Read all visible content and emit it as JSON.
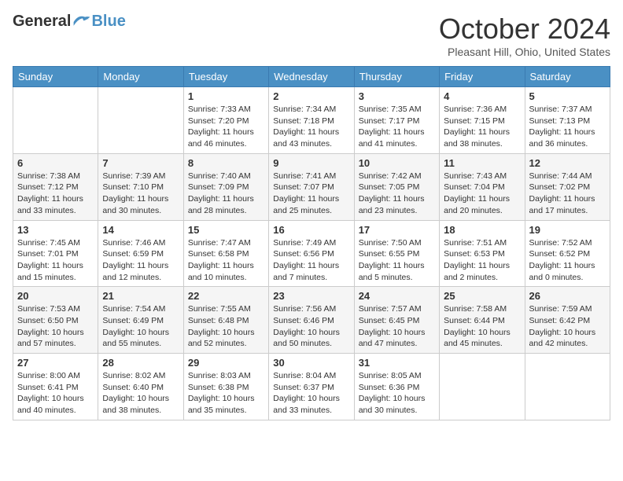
{
  "header": {
    "logo_general": "General",
    "logo_blue": "Blue",
    "title": "October 2024",
    "location": "Pleasant Hill, Ohio, United States"
  },
  "weekdays": [
    "Sunday",
    "Monday",
    "Tuesday",
    "Wednesday",
    "Thursday",
    "Friday",
    "Saturday"
  ],
  "weeks": [
    [
      {
        "day": "",
        "info": ""
      },
      {
        "day": "",
        "info": ""
      },
      {
        "day": "1",
        "info": "Sunrise: 7:33 AM\nSunset: 7:20 PM\nDaylight: 11 hours and 46 minutes."
      },
      {
        "day": "2",
        "info": "Sunrise: 7:34 AM\nSunset: 7:18 PM\nDaylight: 11 hours and 43 minutes."
      },
      {
        "day": "3",
        "info": "Sunrise: 7:35 AM\nSunset: 7:17 PM\nDaylight: 11 hours and 41 minutes."
      },
      {
        "day": "4",
        "info": "Sunrise: 7:36 AM\nSunset: 7:15 PM\nDaylight: 11 hours and 38 minutes."
      },
      {
        "day": "5",
        "info": "Sunrise: 7:37 AM\nSunset: 7:13 PM\nDaylight: 11 hours and 36 minutes."
      }
    ],
    [
      {
        "day": "6",
        "info": "Sunrise: 7:38 AM\nSunset: 7:12 PM\nDaylight: 11 hours and 33 minutes."
      },
      {
        "day": "7",
        "info": "Sunrise: 7:39 AM\nSunset: 7:10 PM\nDaylight: 11 hours and 30 minutes."
      },
      {
        "day": "8",
        "info": "Sunrise: 7:40 AM\nSunset: 7:09 PM\nDaylight: 11 hours and 28 minutes."
      },
      {
        "day": "9",
        "info": "Sunrise: 7:41 AM\nSunset: 7:07 PM\nDaylight: 11 hours and 25 minutes."
      },
      {
        "day": "10",
        "info": "Sunrise: 7:42 AM\nSunset: 7:05 PM\nDaylight: 11 hours and 23 minutes."
      },
      {
        "day": "11",
        "info": "Sunrise: 7:43 AM\nSunset: 7:04 PM\nDaylight: 11 hours and 20 minutes."
      },
      {
        "day": "12",
        "info": "Sunrise: 7:44 AM\nSunset: 7:02 PM\nDaylight: 11 hours and 17 minutes."
      }
    ],
    [
      {
        "day": "13",
        "info": "Sunrise: 7:45 AM\nSunset: 7:01 PM\nDaylight: 11 hours and 15 minutes."
      },
      {
        "day": "14",
        "info": "Sunrise: 7:46 AM\nSunset: 6:59 PM\nDaylight: 11 hours and 12 minutes."
      },
      {
        "day": "15",
        "info": "Sunrise: 7:47 AM\nSunset: 6:58 PM\nDaylight: 11 hours and 10 minutes."
      },
      {
        "day": "16",
        "info": "Sunrise: 7:49 AM\nSunset: 6:56 PM\nDaylight: 11 hours and 7 minutes."
      },
      {
        "day": "17",
        "info": "Sunrise: 7:50 AM\nSunset: 6:55 PM\nDaylight: 11 hours and 5 minutes."
      },
      {
        "day": "18",
        "info": "Sunrise: 7:51 AM\nSunset: 6:53 PM\nDaylight: 11 hours and 2 minutes."
      },
      {
        "day": "19",
        "info": "Sunrise: 7:52 AM\nSunset: 6:52 PM\nDaylight: 11 hours and 0 minutes."
      }
    ],
    [
      {
        "day": "20",
        "info": "Sunrise: 7:53 AM\nSunset: 6:50 PM\nDaylight: 10 hours and 57 minutes."
      },
      {
        "day": "21",
        "info": "Sunrise: 7:54 AM\nSunset: 6:49 PM\nDaylight: 10 hours and 55 minutes."
      },
      {
        "day": "22",
        "info": "Sunrise: 7:55 AM\nSunset: 6:48 PM\nDaylight: 10 hours and 52 minutes."
      },
      {
        "day": "23",
        "info": "Sunrise: 7:56 AM\nSunset: 6:46 PM\nDaylight: 10 hours and 50 minutes."
      },
      {
        "day": "24",
        "info": "Sunrise: 7:57 AM\nSunset: 6:45 PM\nDaylight: 10 hours and 47 minutes."
      },
      {
        "day": "25",
        "info": "Sunrise: 7:58 AM\nSunset: 6:44 PM\nDaylight: 10 hours and 45 minutes."
      },
      {
        "day": "26",
        "info": "Sunrise: 7:59 AM\nSunset: 6:42 PM\nDaylight: 10 hours and 42 minutes."
      }
    ],
    [
      {
        "day": "27",
        "info": "Sunrise: 8:00 AM\nSunset: 6:41 PM\nDaylight: 10 hours and 40 minutes."
      },
      {
        "day": "28",
        "info": "Sunrise: 8:02 AM\nSunset: 6:40 PM\nDaylight: 10 hours and 38 minutes."
      },
      {
        "day": "29",
        "info": "Sunrise: 8:03 AM\nSunset: 6:38 PM\nDaylight: 10 hours and 35 minutes."
      },
      {
        "day": "30",
        "info": "Sunrise: 8:04 AM\nSunset: 6:37 PM\nDaylight: 10 hours and 33 minutes."
      },
      {
        "day": "31",
        "info": "Sunrise: 8:05 AM\nSunset: 6:36 PM\nDaylight: 10 hours and 30 minutes."
      },
      {
        "day": "",
        "info": ""
      },
      {
        "day": "",
        "info": ""
      }
    ]
  ]
}
